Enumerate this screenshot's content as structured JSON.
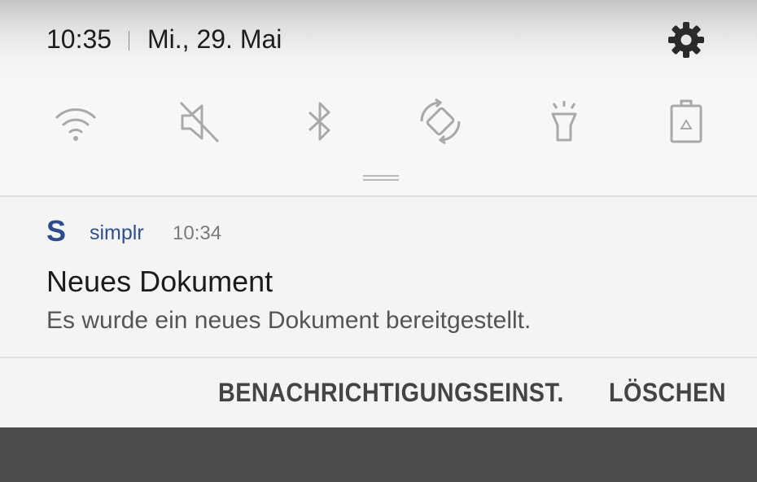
{
  "status_bar": {
    "time": "10:35",
    "date": "Mi., 29. Mai",
    "settings_icon": "gear-icon"
  },
  "quick_settings": {
    "icons": [
      "wifi-icon",
      "sound-muted-icon",
      "bluetooth-icon",
      "auto-rotate-icon",
      "flashlight-icon",
      "power-saving-battery-icon"
    ],
    "icon_color": "#a9a9a9"
  },
  "notification": {
    "app_icon_letter": "S",
    "app_name": "simplr",
    "time": "10:34",
    "title": "Neues Dokument",
    "body": "Es wurde ein neues Dokument bereitgestellt.",
    "accent_color": "#2f4f92"
  },
  "actions": {
    "settings_label": "BENACHRICHTIGUNGSEINST.",
    "clear_label": "LÖSCHEN"
  }
}
